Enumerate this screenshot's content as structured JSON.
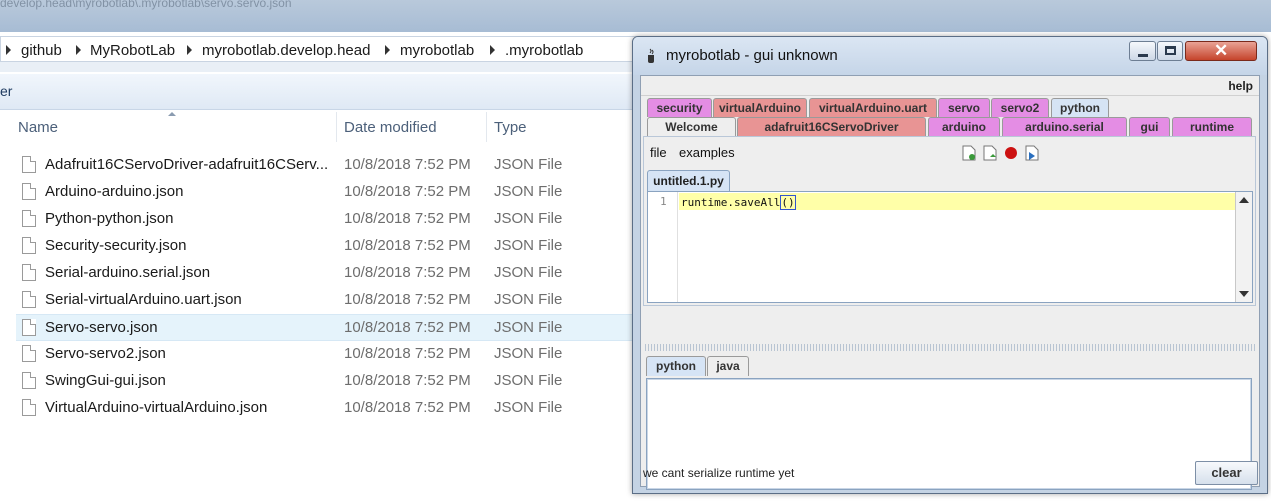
{
  "explorer": {
    "blurred_title": "develop.head\\myrobotlab\\.myrobotlab\\servo.servo.json",
    "breadcrumb": [
      "github",
      "MyRobotLab",
      "myrobotlab.develop.head",
      "myrobotlab",
      ".myrobotlab"
    ],
    "strip_text": "er",
    "columns": {
      "name": "Name",
      "date": "Date modified",
      "type": "Type"
    },
    "files": [
      {
        "name": "Adafruit16CServoDriver-adafruit16CServ...",
        "date": "10/8/2018 7:52 PM",
        "type": "JSON File"
      },
      {
        "name": "Arduino-arduino.json",
        "date": "10/8/2018 7:52 PM",
        "type": "JSON File"
      },
      {
        "name": "Python-python.json",
        "date": "10/8/2018 7:52 PM",
        "type": "JSON File"
      },
      {
        "name": "Security-security.json",
        "date": "10/8/2018 7:52 PM",
        "type": "JSON File"
      },
      {
        "name": "Serial-arduino.serial.json",
        "date": "10/8/2018 7:52 PM",
        "type": "JSON File"
      },
      {
        "name": "Serial-virtualArduino.uart.json",
        "date": "10/8/2018 7:52 PM",
        "type": "JSON File"
      },
      {
        "name": "Servo-servo.json",
        "date": "10/8/2018 7:52 PM",
        "type": "JSON File",
        "selected": true
      },
      {
        "name": "Servo-servo2.json",
        "date": "10/8/2018 7:52 PM",
        "type": "JSON File"
      },
      {
        "name": "SwingGui-gui.json",
        "date": "10/8/2018 7:52 PM",
        "type": "JSON File"
      },
      {
        "name": "VirtualArduino-virtualArduino.json",
        "date": "10/8/2018 7:52 PM",
        "type": "JSON File"
      }
    ]
  },
  "mrl": {
    "title": "myrobotlab - gui unknown",
    "menu": {
      "help": "help"
    },
    "tabs_row1": [
      {
        "label": "security",
        "color": "#e48de4"
      },
      {
        "label": "virtualArduino",
        "color": "#e89494"
      },
      {
        "label": "virtualArduino.uart",
        "color": "#e89494"
      },
      {
        "label": "servo",
        "color": "#e48de4"
      },
      {
        "label": "servo2",
        "color": "#e48de4"
      },
      {
        "label": "python",
        "color": "#d6e4f5"
      }
    ],
    "tabs_row2": [
      {
        "label": "Welcome",
        "color": "#eeeeee"
      },
      {
        "label": "adafruit16CServoDriver",
        "color": "#e89494"
      },
      {
        "label": "arduino",
        "color": "#e48de4"
      },
      {
        "label": "arduino.serial",
        "color": "#e48de4"
      },
      {
        "label": "gui",
        "color": "#e48de4"
      },
      {
        "label": "runtime",
        "color": "#e48de4"
      }
    ],
    "editor_menu": {
      "file": "file",
      "examples": "examples"
    },
    "toolbar_icons": [
      "new-file-icon",
      "open-file-icon",
      "stop-icon",
      "run-icon"
    ],
    "file_tab": "untitled.1.py",
    "code": {
      "line_number": "1",
      "before": "runtime.saveAll",
      "paren_open": "(",
      "paren_close": ")"
    },
    "console_tabs": [
      "python",
      "java"
    ],
    "status_text": "we cant serialize runtime yet",
    "clear_label": "clear"
  }
}
